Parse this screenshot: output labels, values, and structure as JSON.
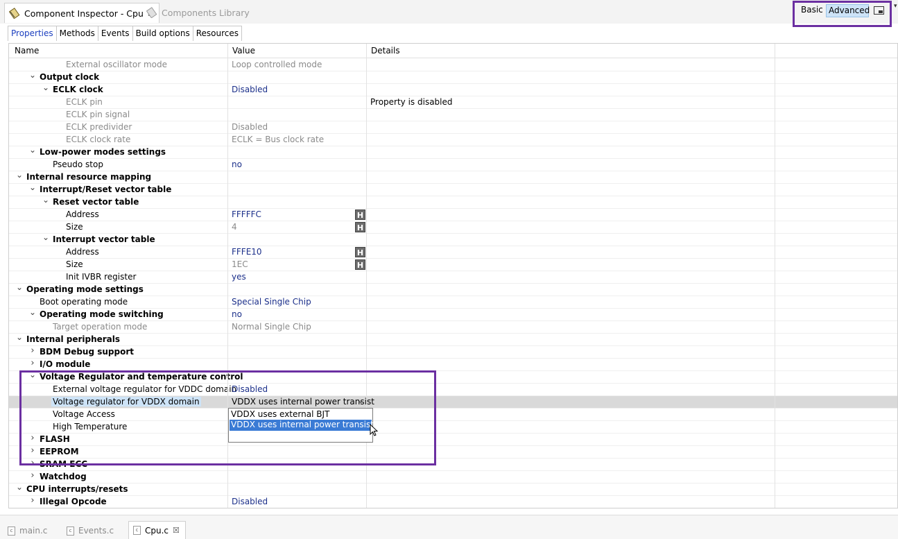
{
  "view_tabs": {
    "inspector_title": "Component Inspector - Cpu",
    "library_title": "Components Library",
    "close_glyph": "☒"
  },
  "mode": {
    "basic": "Basic",
    "advanced": "Advanced",
    "selected": "Advanced"
  },
  "prop_tabs": [
    "Properties",
    "Methods",
    "Events",
    "Build options",
    "Resources"
  ],
  "columns": {
    "name": "Name",
    "value": "Value",
    "details": "Details"
  },
  "rows": [
    {
      "name": "External oscillator mode",
      "value": "Loop controlled mode",
      "disabled": true
    },
    {
      "name": "Output clock",
      "bold": true,
      "expanded": true
    },
    {
      "name": "ECLK clock",
      "bold": true,
      "expanded": true,
      "value": "Disabled"
    },
    {
      "name": "ECLK pin",
      "disabled": true,
      "details": "Property is disabled"
    },
    {
      "name": "ECLK pin signal",
      "disabled": true
    },
    {
      "name": "ECLK predivider",
      "disabled": true,
      "value": "Disabled"
    },
    {
      "name": "ECLK clock rate",
      "disabled": true,
      "value": "ECLK = Bus clock rate"
    },
    {
      "name": "Low-power modes settings",
      "bold": true,
      "expanded": true
    },
    {
      "name": "Pseudo stop",
      "value": "no"
    },
    {
      "name": "Internal resource mapping",
      "bold": true,
      "expanded": true
    },
    {
      "name": "Interrupt/Reset vector table",
      "bold": true,
      "expanded": true
    },
    {
      "name": "Reset vector table",
      "bold": true,
      "expanded": true
    },
    {
      "name": "Address",
      "value": "FFFFFC",
      "hbutton": "H"
    },
    {
      "name": "Size",
      "value": "4",
      "value_disabled": true,
      "hbutton": "H"
    },
    {
      "name": "Interrupt vector table",
      "bold": true,
      "expanded": true
    },
    {
      "name": "Address",
      "value": "FFFE10",
      "hbutton": "H"
    },
    {
      "name": "Size",
      "value": "1EC",
      "value_disabled": true,
      "hbutton": "H"
    },
    {
      "name": "Init IVBR register",
      "value": "yes"
    },
    {
      "name": "Operating mode settings",
      "bold": true,
      "expanded": true
    },
    {
      "name": "Boot operating mode",
      "value": "Special Single Chip"
    },
    {
      "name": "Operating mode switching",
      "bold": true,
      "expanded": true,
      "value": "no"
    },
    {
      "name": "Target operation mode",
      "disabled": true,
      "value": "Normal Single Chip"
    },
    {
      "name": "Internal peripherals",
      "bold": true,
      "expanded": true
    },
    {
      "name": "BDM Debug support",
      "bold": true,
      "expanded": false
    },
    {
      "name": "I/O module",
      "bold": true,
      "expanded": false
    },
    {
      "name": "Voltage Regulator and temperature control",
      "bold": true,
      "expanded": true
    },
    {
      "name": "External voltage regulator for VDDC domain",
      "value": "Disabled"
    },
    {
      "name": "Voltage regulator for VDDX domain",
      "value": "VDDX uses internal power transist",
      "selected": true,
      "dropdown": true
    },
    {
      "name": "Voltage Access"
    },
    {
      "name": "High Temperature"
    },
    {
      "name": "FLASH",
      "bold": true,
      "expanded": false
    },
    {
      "name": "EEPROM",
      "bold": true,
      "expanded": false
    },
    {
      "name": "SRAM ECC",
      "bold": true,
      "expanded": false
    },
    {
      "name": "Watchdog",
      "bold": true,
      "expanded": false
    },
    {
      "name": "CPU interrupts/resets",
      "bold": true,
      "expanded": true
    },
    {
      "name": "Illegal Opcode",
      "bold": true,
      "expanded": false,
      "value": "Disabled"
    }
  ],
  "dropdown_options": [
    "VDDX uses external BJT",
    "VDDX uses internal power transistor"
  ],
  "dropdown_selected": "VDDX uses internal power transistor",
  "editor_tabs": [
    {
      "label": "main.c"
    },
    {
      "label": "Events.c"
    },
    {
      "label": "Cpu.c",
      "active": true
    }
  ],
  "file_icon_text": "c",
  "colors": {
    "highlight_frame": "#6b2fa1",
    "selection": "#3a7bd5",
    "value_blue": "#1b2f8a"
  }
}
